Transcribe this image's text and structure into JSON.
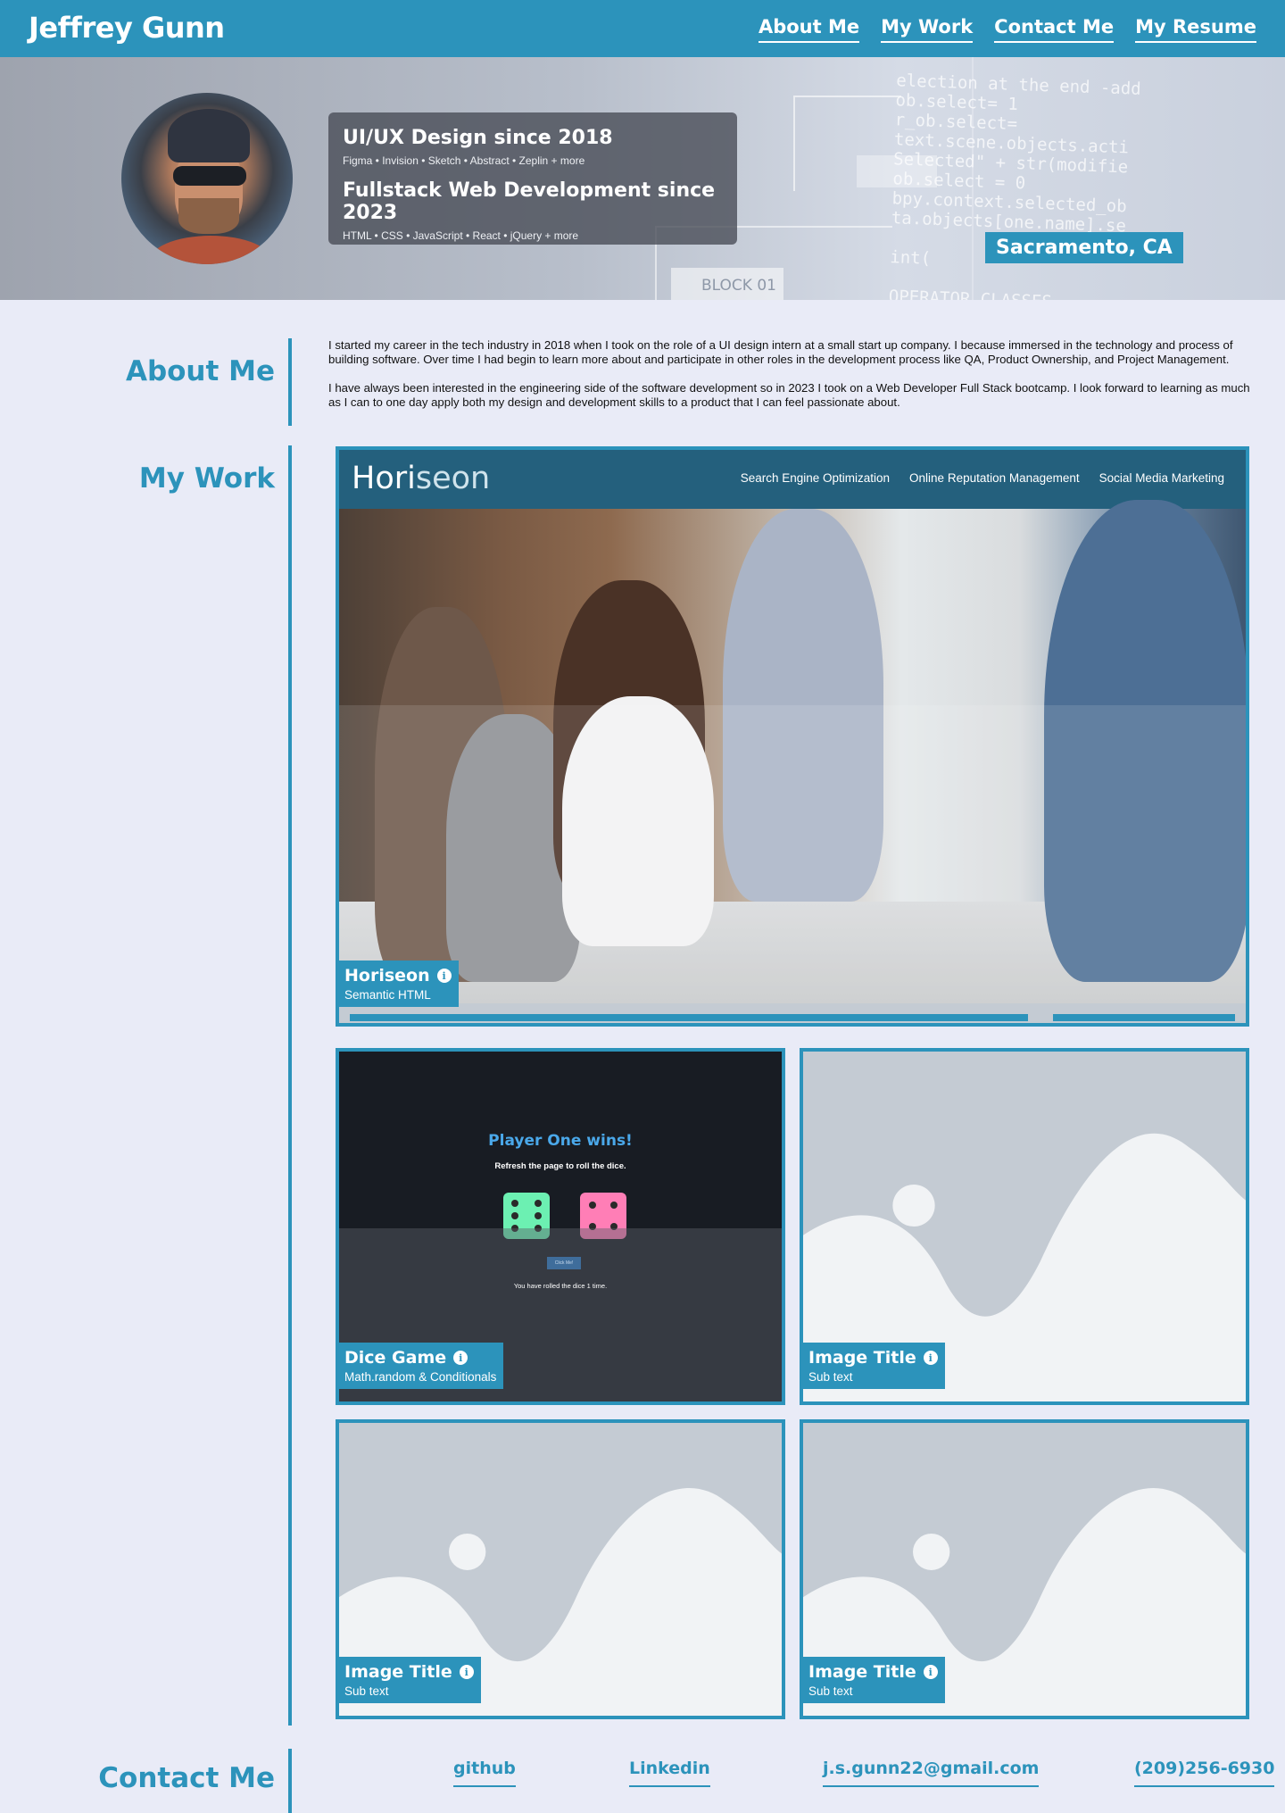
{
  "header": {
    "brand": "Jeffrey Gunn",
    "nav": [
      "About Me",
      "My Work",
      "Contact Me",
      "My Resume"
    ]
  },
  "hero": {
    "skills": [
      {
        "title": "UI/UX Design since 2018",
        "tools": "Figma • Invision • Sketch • Abstract • Zeplin + more"
      },
      {
        "title": "Fullstack Web Development since 2023",
        "tools": "HTML • CSS • JavaScript • React • jQuery + more"
      }
    ],
    "location": "Sacramento, CA",
    "code_text": "election at the end -add\nob.select= 1\nr_ob.select=\ntext.scene.objects.acti\nSelected\" + str(modifie\nob.select = 0\nbpy.context.selected_ob\nta.objects[one.name].se\n\nint(\n\nOPERATOR CLASSES ------",
    "block_label": "BLOCK 01"
  },
  "about": {
    "title": "About Me",
    "paragraphs": [
      "I started my career in the tech industry in 2018 when I took on the role of a UI design intern at a small start up company. I because immersed in the technology and process of building software. Over time I had begin to learn more about and participate in other roles in the development process like QA, Product Ownership, and Project Management.",
      "I have always been interested in the engineering side of the software development so in 2023 I took on a Web Developer Full Stack bootcamp. I look forward to learning as much as I can to one day apply both my design and development skills to a product that I can feel passionate about."
    ]
  },
  "work": {
    "title": "My Work",
    "featured": {
      "title": "Horiseon",
      "subtitle": "Semantic HTML",
      "logo_main": "Hori",
      "logo_accent": "seon",
      "nav": [
        "Search Engine Optimization",
        "Online Reputation Management",
        "Social Media Marketing"
      ]
    },
    "dice": {
      "title": "Dice Game",
      "subtitle": "Math.random & Conditionals",
      "heading": "Player One wins!",
      "instruction": "Refresh the page to roll the dice.",
      "button": "Click Me!",
      "rolled": "You have rolled the dice 1 time.",
      "die_colors": [
        "#6cf0b2",
        "#ff7eb6"
      ]
    },
    "placeholders": [
      {
        "title": "Image Title",
        "subtitle": "Sub text"
      },
      {
        "title": "Image Title",
        "subtitle": "Sub text"
      },
      {
        "title": "Image Title",
        "subtitle": "Sub text"
      }
    ]
  },
  "contact": {
    "title": "Contact Me",
    "links": [
      "github",
      "Linkedin",
      "j.s.gunn22@gmail.com",
      "(209)256-6930"
    ]
  },
  "colors": {
    "accent": "#2c93bb",
    "background": "#e9ebf7"
  }
}
